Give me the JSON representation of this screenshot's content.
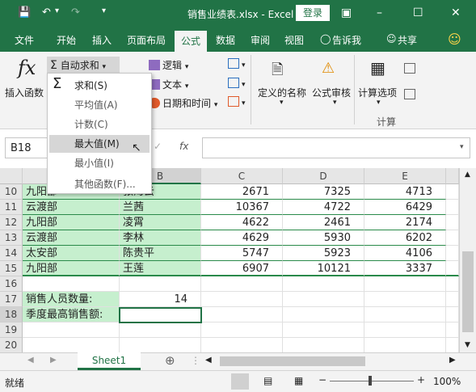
{
  "window": {
    "title": "销售业绩表.xlsx - Excel",
    "login_label": "登录"
  },
  "menu": [
    "文件",
    "开始",
    "插入",
    "页面布局",
    "公式",
    "数据",
    "审阅",
    "视图",
    "告诉我",
    "共享"
  ],
  "ribbon": {
    "insert_function": "插入函数",
    "autosum": "自动求和",
    "logical": "逻辑",
    "text": "文本",
    "datetime": "日期和时间",
    "defined_names": "定义的名称",
    "formula_audit": "公式审核",
    "calc_options": "计算选项",
    "calc_group": "计算"
  },
  "autosum_menu": [
    "求和(S)",
    "平均值(A)",
    "计数(C)",
    "最大值(M)",
    "最小值(I)",
    "其他函数(F)..."
  ],
  "namebox": "B18",
  "columns": [
    "B",
    "C",
    "D",
    "E"
  ],
  "rows": [
    {
      "n": "10",
      "a": "九阳部",
      "b": "张海云",
      "c": "2671",
      "d": "7325",
      "e": "4713"
    },
    {
      "n": "11",
      "a": "云渡部",
      "b": "兰茜",
      "c": "10367",
      "d": "4722",
      "e": "6429"
    },
    {
      "n": "12",
      "a": "九阳部",
      "b": "凌霄",
      "c": "4622",
      "d": "2461",
      "e": "2174"
    },
    {
      "n": "13",
      "a": "云渡部",
      "b": "李林",
      "c": "4629",
      "d": "5930",
      "e": "6202"
    },
    {
      "n": "14",
      "a": "太安部",
      "b": "陈贵平",
      "c": "5747",
      "d": "5923",
      "e": "4106"
    },
    {
      "n": "15",
      "a": "九阳部",
      "b": "王莲",
      "c": "6907",
      "d": "10121",
      "e": "3337"
    },
    {
      "n": "16",
      "a": "",
      "b": "",
      "c": "",
      "d": "",
      "e": ""
    },
    {
      "n": "17",
      "a": "销售人员数量:",
      "b": "14",
      "c": "",
      "d": "",
      "e": ""
    },
    {
      "n": "18",
      "a": "季度最高销售额:",
      "b": "",
      "c": "",
      "d": "",
      "e": ""
    },
    {
      "n": "19",
      "a": "",
      "b": "",
      "c": "",
      "d": "",
      "e": ""
    },
    {
      "n": "20",
      "a": "",
      "b": "",
      "c": "",
      "d": "",
      "e": ""
    }
  ],
  "sheet_tab": "Sheet1",
  "status": {
    "ready": "就绪",
    "zoom": "100%"
  }
}
